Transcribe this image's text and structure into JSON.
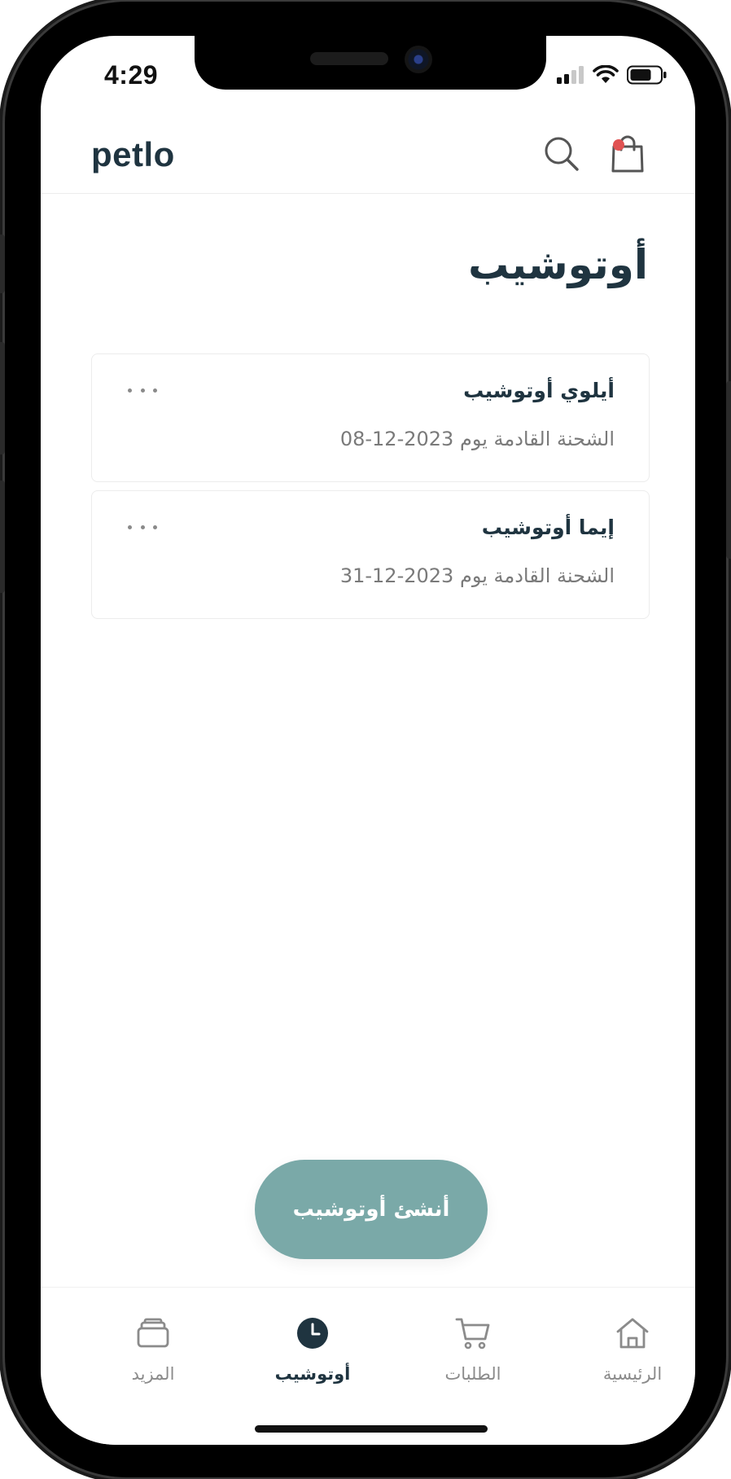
{
  "status_bar": {
    "time": "4:29"
  },
  "header": {
    "logo": "petlo",
    "search_icon": "search-icon",
    "cart_icon": "shopping-bag-icon",
    "cart_badge_color": "#e05252"
  },
  "page": {
    "title": "أوتوشيب"
  },
  "autoships": [
    {
      "name": "أيلوي أوتوشيب",
      "next_shipment": "الشحنة القادمة يوم 2023-12-08"
    },
    {
      "name": "إيما أوتوشيب",
      "next_shipment": "الشحنة القادمة يوم 2023-12-31"
    }
  ],
  "create_button": {
    "label": "أنشئ أوتوشيب",
    "color": "#7aa9a8"
  },
  "tabbar": {
    "items": [
      {
        "label": "المزيد",
        "icon": "stack-icon",
        "active": false
      },
      {
        "label": "أوتوشيب",
        "icon": "clock-icon",
        "active": true
      },
      {
        "label": "الطلبات",
        "icon": "cart-icon",
        "active": false
      },
      {
        "label": "الرئيسية",
        "icon": "home-icon",
        "active": false
      }
    ]
  },
  "colors": {
    "primary_text": "#1f3440",
    "secondary_text": "#7a7a7a",
    "accent": "#7aa9a8"
  }
}
